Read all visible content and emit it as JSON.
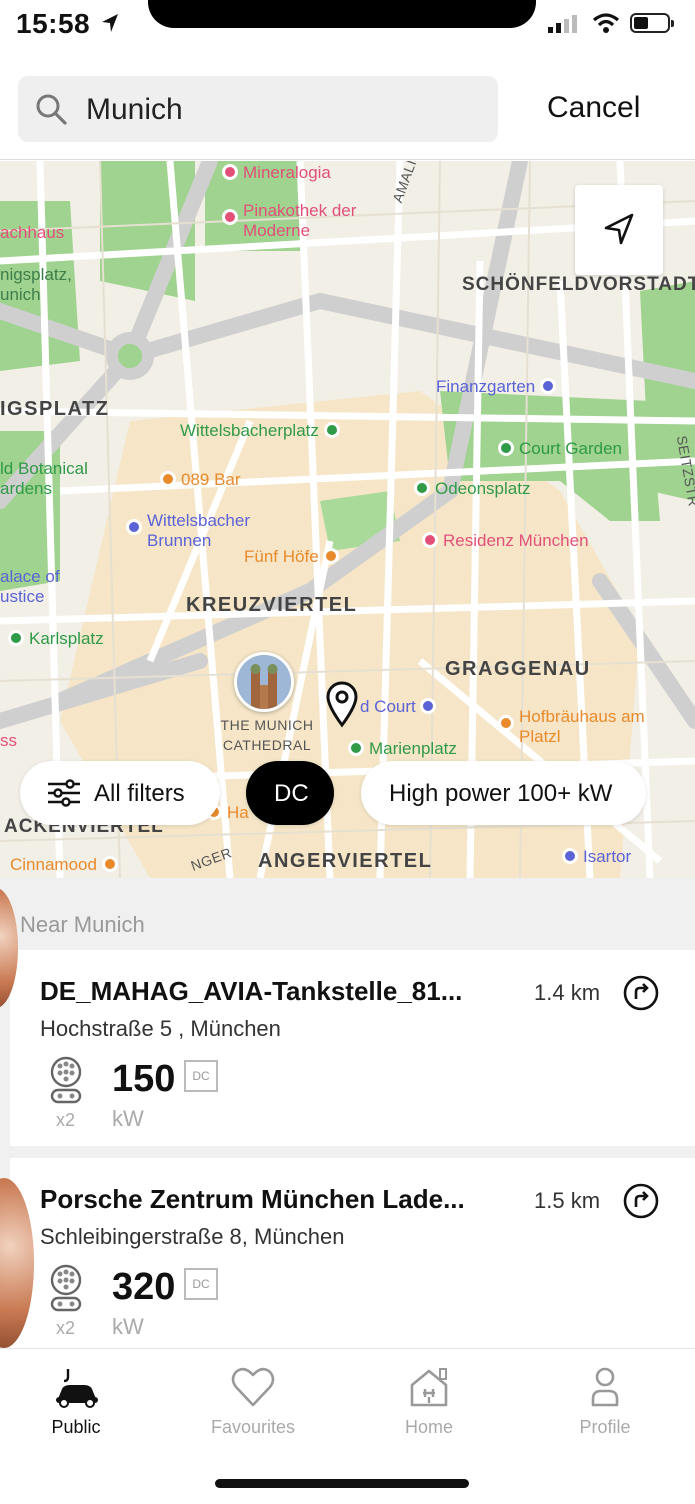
{
  "status_bar": {
    "time": "15:58"
  },
  "search": {
    "value": "Munich",
    "cancel_label": "Cancel"
  },
  "map": {
    "districts": {
      "schoenfeldvorstadt": "SCHÖNFELDVORSTADT",
      "kreuzviertel": "KREUZVIERTEL",
      "graggenau": "GRAGGENAU",
      "angerviertel": "ANGERVIERTEL",
      "igsplatz": "IGSPLATZ",
      "hackenviertel": "ACKENVIERTEL"
    },
    "pois": {
      "mineralogia": "Mineralogia",
      "pinakothek": "Pinakothek der Moderne",
      "achhaus": "achhaus",
      "nigsplatz": "nigsplatz, unich",
      "finanzgarten": "Finanzgarten",
      "wittelsbacherplatz": "Wittelsbacherplatz",
      "court_garden": "Court Garden",
      "botanical": "ld Botanical ardens",
      "bar_089": "089 Bar",
      "odeonsplatz": "Odeonsplatz",
      "wittelsbacher_brunnen": "Wittelsbacher Brunnen",
      "residenz": "Residenz München",
      "fuenf_hoefe": "Fünf Höfe",
      "palace_justice": "alace of ustice",
      "karlsplatz": "Karlsplatz",
      "cathedral": "THE MUNICH CATHEDRAL",
      "old_court": "d Court",
      "hofbraeuhaus": "Hofbräuhaus am Platzl",
      "marienplatz": "Marienplatz",
      "cinnamood": "Cinnamood",
      "isartor": "Isartor",
      "ha": "Ha",
      "amali": "AMALI",
      "seitzstr": "SEITZSTR",
      "nger": "NGER",
      "ss": "ss"
    }
  },
  "filters": {
    "all_filters": "All filters",
    "dc": "DC",
    "high_power": "High power 100+ kW"
  },
  "list": {
    "section_title": "Near Munich",
    "stations": [
      {
        "name": "DE_MAHAG_AVIA-Tankstelle_81...",
        "address": "Hochstraße 5 , München",
        "distance": "1.4 km",
        "connectors": "x2",
        "power": "150",
        "unit": "kW",
        "current": "DC"
      },
      {
        "name": "Porsche Zentrum München Lade...",
        "address": "Schleibingerstraße  8, München",
        "distance": "1.5 km",
        "connectors": "x2",
        "power": "320",
        "unit": "kW",
        "current": "DC"
      }
    ]
  },
  "tabs": [
    {
      "label": "Public",
      "icon": "car-charging-icon",
      "active": true
    },
    {
      "label": "Favourites",
      "icon": "heart-icon",
      "active": false
    },
    {
      "label": "Home",
      "icon": "home-charger-icon",
      "active": false
    },
    {
      "label": "Profile",
      "icon": "person-icon",
      "active": false
    }
  ],
  "colors": {
    "accent": "#000000",
    "park": "#8fd08a",
    "poi_green": "#2f9a47",
    "poi_pink": "#e2507a",
    "poi_blue": "#5b63d6",
    "poi_orange": "#e98a2c"
  }
}
